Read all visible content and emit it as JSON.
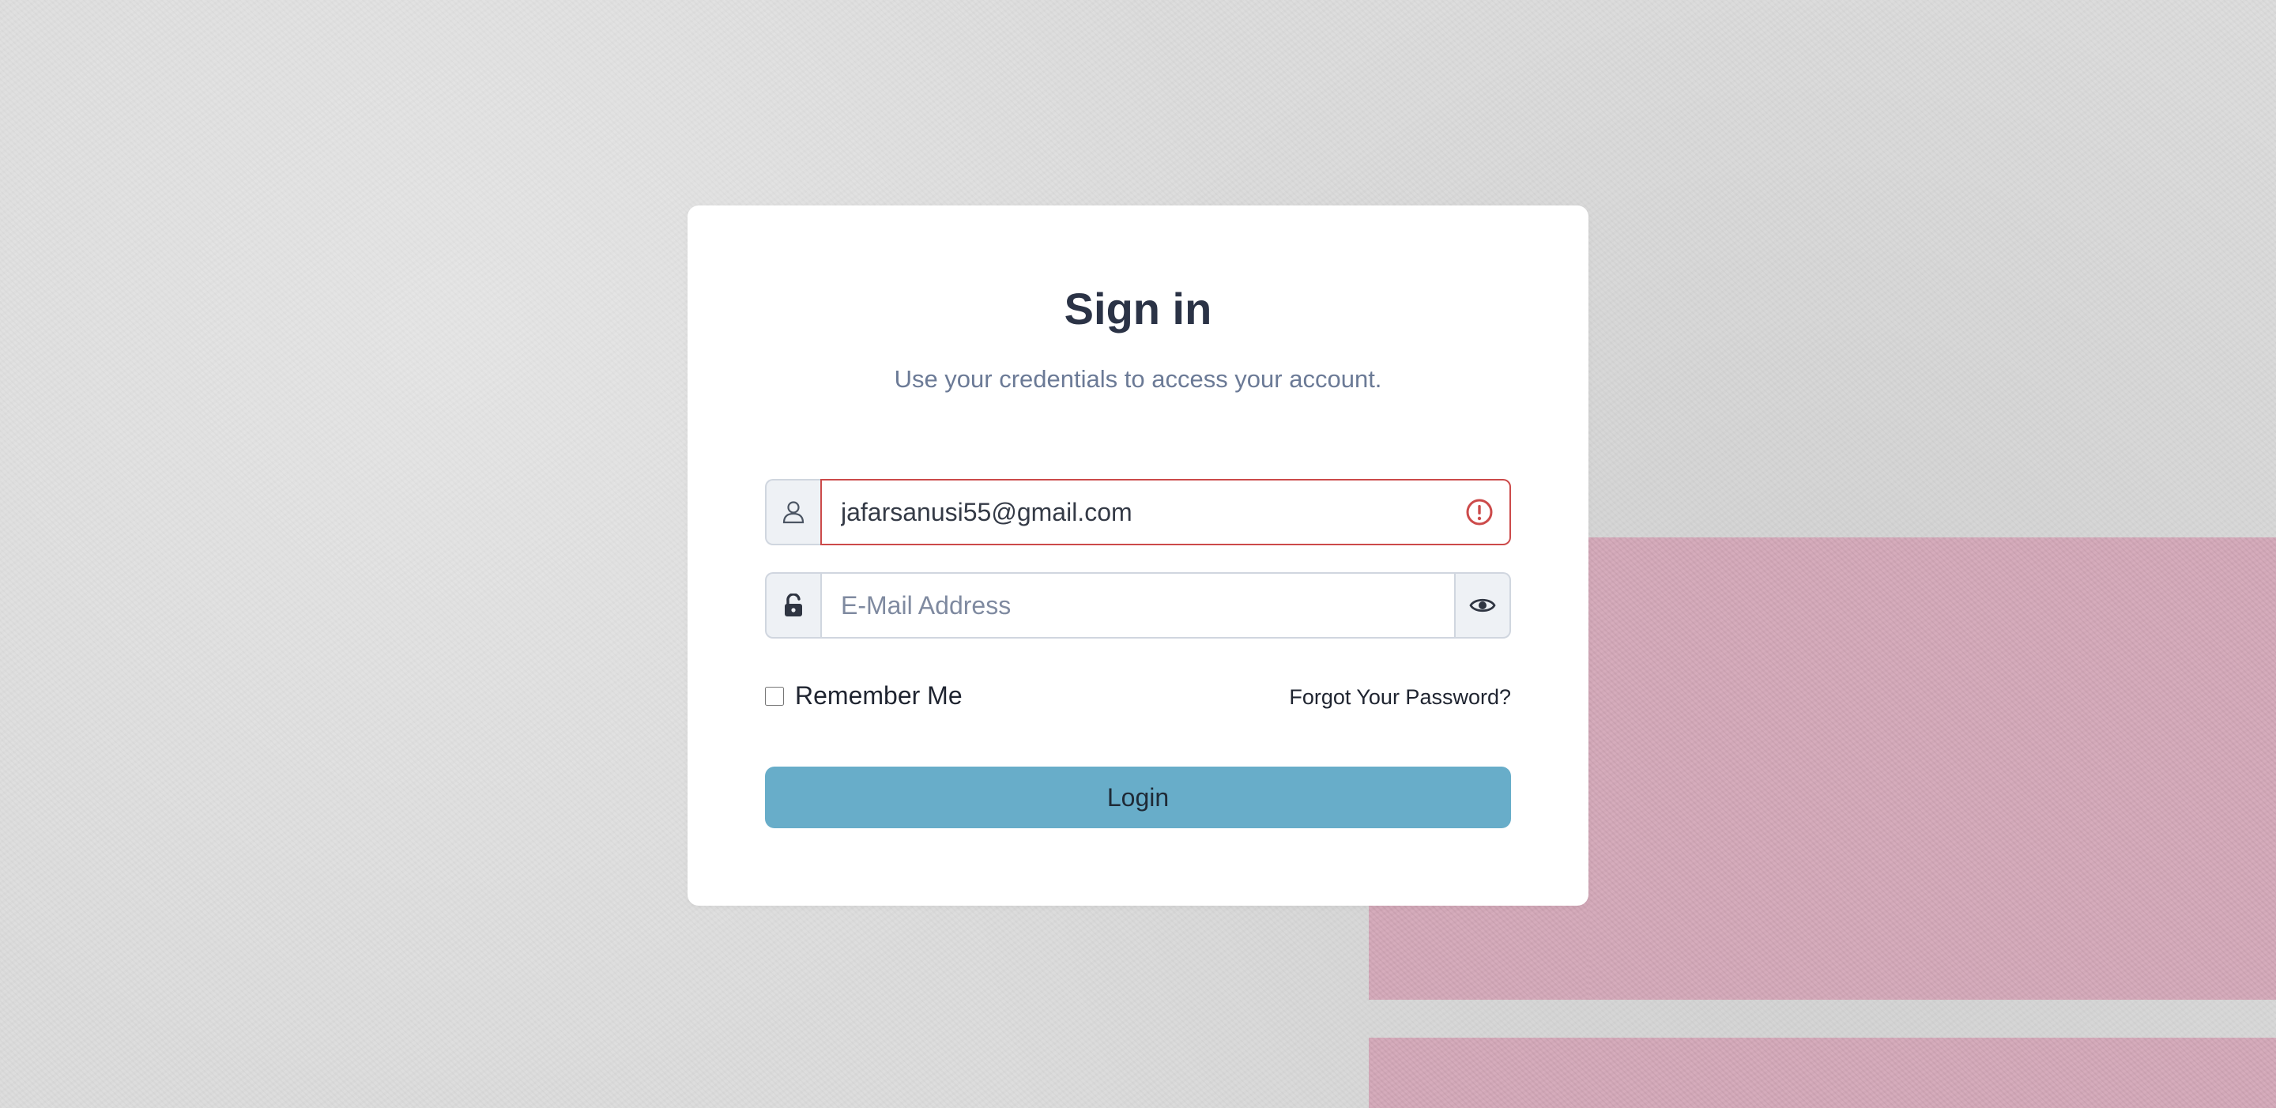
{
  "login": {
    "title": "Sign in",
    "subtitle": "Use your credentials to access your account.",
    "email_value": "jafarsanusi55@gmail.com",
    "password_placeholder": "E-Mail Address",
    "remember_label": "Remember Me",
    "remember_checked": false,
    "forgot_label": "Forgot Your Password?",
    "login_label": "Login"
  },
  "icons": {
    "user": "user-icon",
    "lock": "unlock-icon",
    "eye": "eye-icon",
    "error": "error-exclamation-icon"
  },
  "colors": {
    "primary_button": "#68adc9",
    "error_border": "#cc4a4a",
    "title_text": "#2b3346",
    "subtitle_text": "#6b7a96",
    "background": "#dcdcdc",
    "pink_band": "#d4a8b9"
  }
}
